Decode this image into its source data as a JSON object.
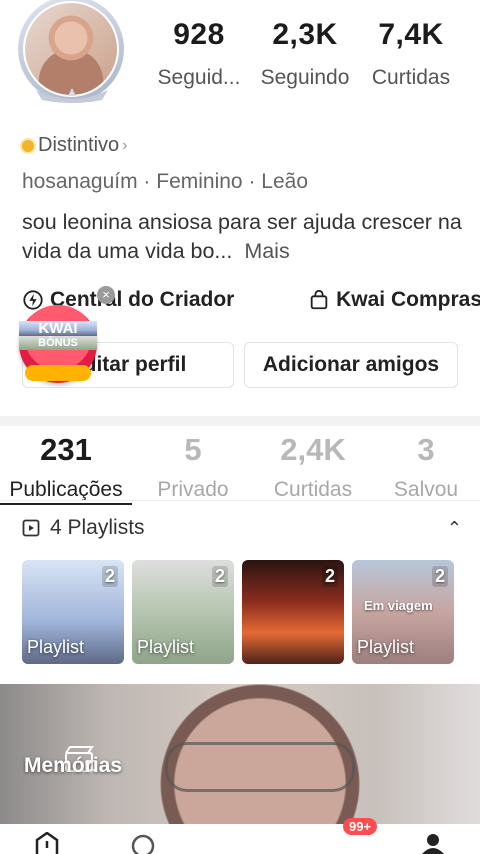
{
  "profile": {
    "stats": [
      {
        "value": "928",
        "label": "Seguid..."
      },
      {
        "value": "2,3K",
        "label": "Seguindo"
      },
      {
        "value": "7,4K",
        "label": "Curtidas"
      }
    ],
    "badge_label": "Distintivo",
    "meta": "hosanaguím · Feminino · Leão",
    "bio": "sou  leonina  ansiosa para  ser ajuda crescer na vida da uma vida bo...",
    "bio_more": "Mais"
  },
  "links": {
    "creator_center": "Central do Criador",
    "shop": "Kwai Compras"
  },
  "buttons": {
    "edit_profile": "Editar perfil",
    "add_friends": "Adicionar amigos"
  },
  "bonus": {
    "line1": "KWAI",
    "line2": "BÔNUS"
  },
  "tabs": [
    {
      "value": "231",
      "label": "Publicações"
    },
    {
      "value": "5",
      "label": "Privado"
    },
    {
      "value": "2,4K",
      "label": "Curtidas"
    },
    {
      "value": "3",
      "label": "Salvou"
    }
  ],
  "playlists": {
    "header": "4 Playlists",
    "items": [
      {
        "count": "2",
        "label": "Playlist",
        "overlay": ""
      },
      {
        "count": "2",
        "label": "Playlist",
        "overlay": ""
      },
      {
        "count": "2",
        "label": "",
        "overlay": ""
      },
      {
        "count": "2",
        "label": "Playlist",
        "overlay": "Em viagem"
      }
    ]
  },
  "memories_label": "Memórias",
  "notification_badge": "99+",
  "colors": {
    "accent_red": "#e21d43",
    "badge_gold": "#f4b429",
    "text_dark": "#1b1b1b",
    "text_muted": "#a8a8a8"
  }
}
